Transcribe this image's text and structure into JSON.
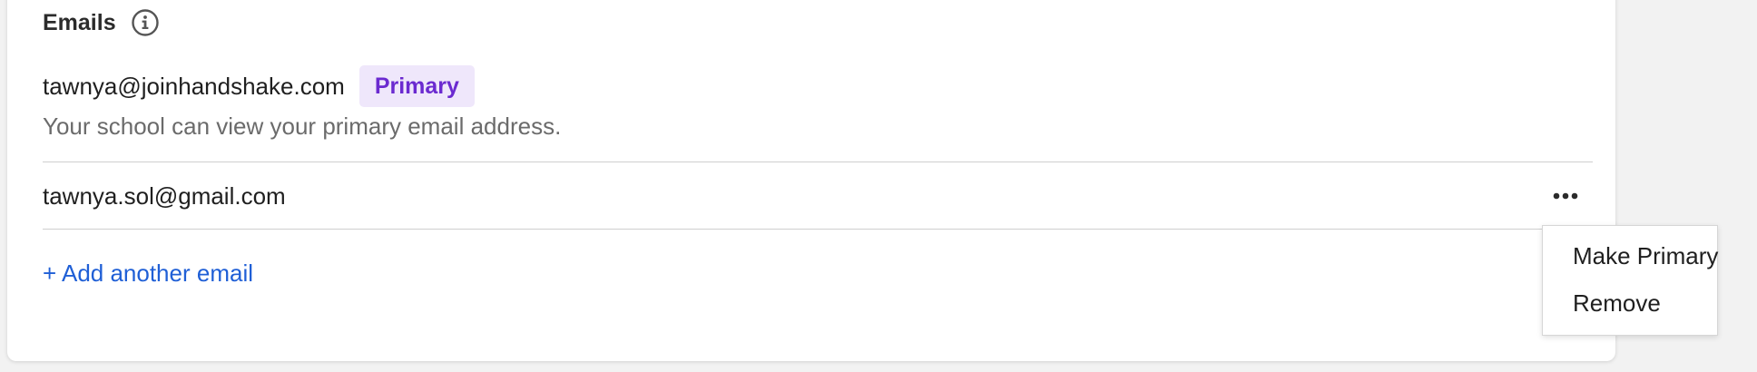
{
  "emails_section": {
    "title": "Emails",
    "info_icon": "info-circle-icon",
    "primary_email": "tawnya@joinhandshake.com",
    "primary_badge": "Primary",
    "primary_helper": "Your school can view your primary email address.",
    "secondary_email": "tawnya.sol@gmail.com",
    "more_icon": "more-horizontal-icon",
    "add_link": "+ Add another email"
  },
  "dropdown_menu": {
    "items": [
      "Make Primary",
      "Remove"
    ]
  },
  "colors": {
    "badge_background": "#efe7fb",
    "badge_text": "#6b2ad0",
    "link": "#1f5fd6",
    "helper_text": "#6b6b6b"
  }
}
